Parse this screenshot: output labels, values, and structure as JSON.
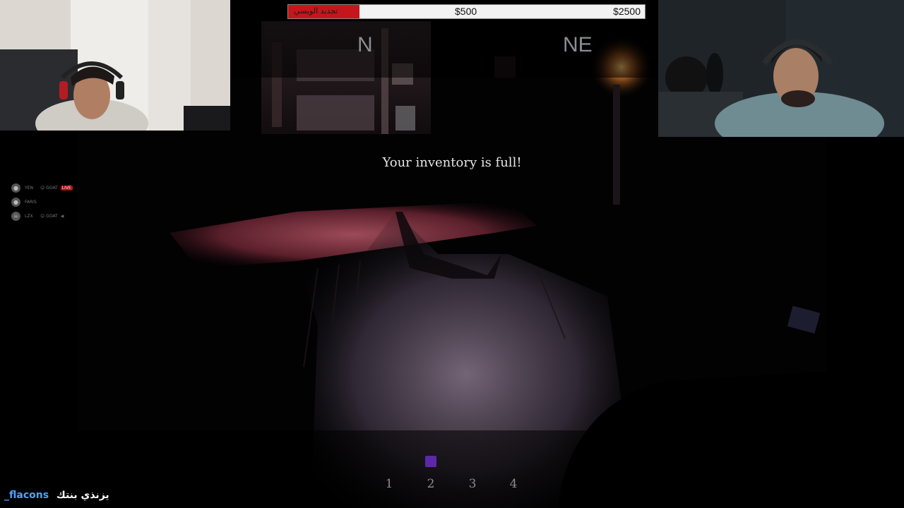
{
  "quota": {
    "label": "تجديد الويسي",
    "current": "$500",
    "target": "$2500",
    "progress": 0.2,
    "fill_color": "#c4161c"
  },
  "compass": {
    "north": "N",
    "north_east": "NE"
  },
  "notification": "Your inventory is full!",
  "players": [
    {
      "name": "YEN",
      "tag": "GOAT",
      "badge": "LIVE",
      "icon": "avatar-icon"
    },
    {
      "name": "FARIS",
      "tag": "",
      "badge": "",
      "icon": "avatar-icon"
    },
    {
      "name": "LZX",
      "tag": "GOAT",
      "badge": "",
      "icon": "skull-icon"
    }
  ],
  "hotbar": {
    "slots": [
      "1",
      "2",
      "3",
      "4"
    ],
    "selected": 2,
    "marker_color": "#6a2bc4"
  },
  "chat": {
    "user": "_flacons",
    "message": "يزنذي بنتك"
  }
}
